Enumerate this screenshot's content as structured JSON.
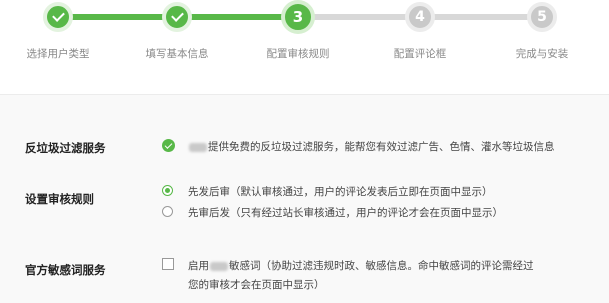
{
  "steps": [
    {
      "number": "1",
      "label": "选择用户类型",
      "status": "done"
    },
    {
      "number": "2",
      "label": "填写基本信息",
      "status": "done"
    },
    {
      "number": "3",
      "label": "配置审核规则",
      "status": "current"
    },
    {
      "number": "4",
      "label": "配置评论框",
      "status": "todo"
    },
    {
      "number": "5",
      "label": "完成与安装",
      "status": "todo"
    }
  ],
  "spam_filter": {
    "label": "反垃圾过滤服务",
    "description": "提供免费的反垃圾过滤服务，能帮您有效过滤广告、色情、灌水等垃圾信息"
  },
  "review_rules": {
    "label": "设置审核规则",
    "options": [
      {
        "text": "先发后审（默认审核通过，用户的评论发表后立即在页面中显示）",
        "selected": true
      },
      {
        "text": "先审后发（只有经过站长审核通过，用户的评论才会在页面中显示）",
        "selected": false
      }
    ]
  },
  "sensitive_words": {
    "label": "官方敏感词服务",
    "checked": false,
    "prefix": "启用",
    "line1": "敏感词（协助过滤违规时政、敏感信息。命中敏感词的评论需经过",
    "line2": "您的审核才会在页面中显示）"
  },
  "colors": {
    "accent": "#58b848",
    "inactive": "#c9c9c9"
  }
}
